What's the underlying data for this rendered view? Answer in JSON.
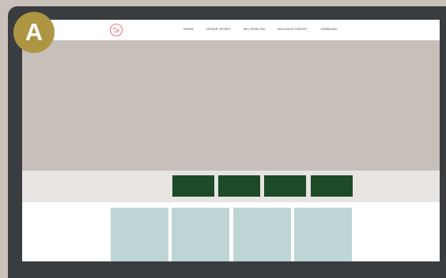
{
  "badge": {
    "letter": "A"
  },
  "header": {
    "logo_icon": "club-logo-icon",
    "nav_items": [
      "NEWS",
      "UNSER SPORT",
      "WO SPIELEN",
      "NACHHALTIGKEIT",
      "VERBAND"
    ]
  },
  "hero": {
    "slides_total": 5,
    "active_slide": 1
  },
  "colors": {
    "page_background": "#c9c2bc",
    "monitor_frame": "#3a3d40",
    "hero_placeholder": "#c7bfba",
    "band_background": "#e7e4e1",
    "green_buttons": "#1d4a27",
    "cards": "#bed5d5",
    "badge": "#ad9541",
    "dot_active": "#d9545c"
  }
}
